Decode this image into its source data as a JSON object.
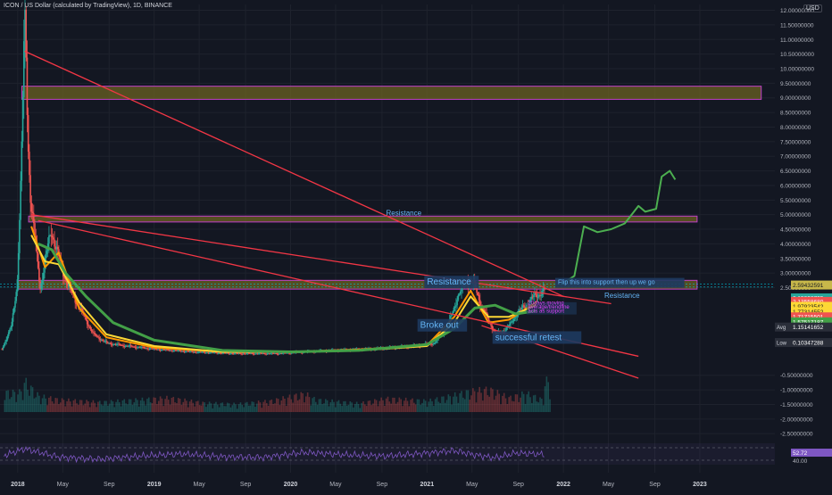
{
  "header": {
    "title": "ICON / US Dollar (calculated by TradingView), 1D, BINANCE",
    "currency": "USD"
  },
  "colors": {
    "background": "#131722",
    "grid": "#1e222d",
    "up": "#26a69a",
    "down": "#ef5350",
    "trendline": "#f23645",
    "zone_fill": "#6b6221",
    "zone_border": "#c040c8",
    "forecast": "#4caf50",
    "ma_green": "#43a047",
    "ma_yellow": "#fdd835",
    "ma_orange": "#ff9800",
    "rsi": "#7e57c2",
    "annotation_box": "#1e3a5f",
    "annotation_text": "#64b5f6",
    "avg_line": "#00bcd4"
  },
  "chart_data": {
    "type": "line",
    "title": "ICON / US Dollar (calculated by TradingView), 1D, BINANCE",
    "xlabel": "",
    "ylabel": "",
    "ylim": [
      -2.8,
      12.2
    ],
    "grid": true,
    "x_ticks": [
      "2018",
      "May",
      "Sep",
      "2019",
      "May",
      "Sep",
      "2020",
      "May",
      "Sep",
      "2021",
      "May",
      "Sep",
      "2022",
      "May",
      "Sep",
      "2023"
    ],
    "y_ticks": [
      "12.00000000",
      "11.50000000",
      "11.00000000",
      "10.50000000",
      "10.00000000",
      "9.50000000",
      "9.00000000",
      "8.50000000",
      "8.00000000",
      "7.50000000",
      "7.00000000",
      "6.50000000",
      "6.00000000",
      "5.50000000",
      "5.00000000",
      "4.50000000",
      "4.00000000",
      "3.50000000",
      "3.00000000",
      "2.50000000",
      "-0.50000000",
      "-1.00000000",
      "-1.50000000",
      "-2.00000000",
      "-2.50000000"
    ],
    "series": [
      {
        "key": "price",
        "x": [
          2017.88,
          2017.95,
          2017.99,
          2018.02,
          2018.04,
          2018.05,
          2018.07,
          2018.09,
          2018.12,
          2018.16,
          2018.2,
          2018.24,
          2018.29,
          2018.33,
          2018.38,
          2018.45,
          2018.55,
          2018.65,
          2018.8,
          2019.0,
          2019.3,
          2019.6,
          2019.9,
          2020.1,
          2020.3,
          2020.6,
          2020.9,
          2021.05,
          2021.15,
          2021.22,
          2021.3,
          2021.35,
          2021.4,
          2021.5,
          2021.55,
          2021.6,
          2021.65,
          2021.72,
          2021.78,
          2021.82,
          2021.86
        ],
        "values": [
          0.4,
          1.2,
          2.6,
          6.5,
          10.5,
          11.7,
          7.5,
          5.5,
          4.2,
          2.5,
          3.5,
          4.5,
          3.6,
          3.0,
          2.4,
          1.8,
          0.9,
          0.6,
          0.5,
          0.4,
          0.3,
          0.25,
          0.25,
          0.3,
          0.35,
          0.4,
          0.5,
          0.6,
          1.2,
          2.2,
          2.8,
          2.5,
          1.8,
          0.9,
          1.0,
          1.2,
          1.6,
          1.9,
          2.2,
          2.3,
          2.4
        ]
      },
      {
        "key": "ma_green",
        "x": [
          2018.15,
          2018.25,
          2018.35,
          2018.5,
          2018.7,
          2019.0,
          2019.5,
          2020.0,
          2020.5,
          2021.0,
          2021.2,
          2021.35,
          2021.5,
          2021.65,
          2021.8
        ],
        "values": [
          4.0,
          3.8,
          3.0,
          2.2,
          1.3,
          0.7,
          0.35,
          0.3,
          0.35,
          0.55,
          1.1,
          1.8,
          1.9,
          1.6,
          1.7
        ]
      },
      {
        "key": "ma_yellow",
        "x": [
          2018.1,
          2018.2,
          2018.3,
          2018.45,
          2018.65,
          2019.0,
          2019.5,
          2020.0,
          2020.5,
          2021.0,
          2021.2,
          2021.32,
          2021.45,
          2021.6,
          2021.8
        ],
        "values": [
          4.3,
          3.4,
          3.3,
          2.0,
          0.9,
          0.5,
          0.3,
          0.3,
          0.35,
          0.5,
          1.3,
          2.2,
          1.5,
          1.5,
          1.9
        ]
      },
      {
        "key": "ma_orange",
        "x": [
          2018.1,
          2018.2,
          2018.3,
          2018.45,
          2018.65,
          2019.0,
          2019.5,
          2020.0,
          2020.5,
          2021.0,
          2021.2,
          2021.32,
          2021.45,
          2021.6,
          2021.8
        ],
        "values": [
          4.6,
          3.2,
          3.7,
          1.8,
          0.8,
          0.45,
          0.3,
          0.3,
          0.38,
          0.52,
          1.5,
          2.4,
          1.3,
          1.4,
          2.0
        ]
      },
      {
        "key": "forecast",
        "x": [
          2021.98,
          2022.08,
          2022.15,
          2022.25,
          2022.35,
          2022.45,
          2022.55,
          2022.6,
          2022.68,
          2022.72,
          2022.78,
          2022.82
        ],
        "values": [
          2.6,
          2.9,
          4.6,
          4.4,
          4.5,
          4.7,
          5.3,
          5.1,
          5.2,
          6.3,
          6.5,
          6.2
        ]
      }
    ],
    "trendlines": [
      {
        "x1": 2018.05,
        "y1": 10.6,
        "x2": 2022.0,
        "y2": 2.2
      },
      {
        "x1": 2018.1,
        "y1": 5.0,
        "x2": 2022.35,
        "y2": 1.95
      },
      {
        "x1": 2018.15,
        "y1": 4.8,
        "x2": 2022.55,
        "y2": 0.15
      },
      {
        "x1": 2021.4,
        "y1": 1.2,
        "x2": 2022.55,
        "y2": -0.6
      }
    ],
    "zones": [
      {
        "x1": 2018.03,
        "x2": 2023.45,
        "y1": 8.95,
        "y2": 9.4
      },
      {
        "x1": 2018.08,
        "x2": 2022.98,
        "y1": 4.75,
        "y2": 4.95
      },
      {
        "x1": 2018.0,
        "x2": 2022.98,
        "y1": 2.45,
        "y2": 2.75
      }
    ],
    "annotations": [
      {
        "text": "Resistance",
        "x": 2020.7,
        "y": 4.98,
        "boxed": false
      },
      {
        "text": "Resistance",
        "x": 2021.0,
        "y": 2.6,
        "boxed": true
      },
      {
        "text": "Flip this into support then up we go",
        "x": 2021.96,
        "y": 2.62,
        "boxed": true
      },
      {
        "text": "Resistance",
        "x": 2022.3,
        "y": 2.15,
        "boxed": false
      },
      {
        "text": "Broke out",
        "x": 2020.95,
        "y": 1.12,
        "boxed": true
      },
      {
        "text": "20days moving",
        "x": 2021.74,
        "y": 1.92,
        "boxed": false
      },
      {
        "text": "average/trendline",
        "x": 2021.74,
        "y": 1.78,
        "boxed": false
      },
      {
        "text": "acts as support",
        "x": 2021.74,
        "y": 1.64,
        "boxed": false
      },
      {
        "text": "successful retest",
        "x": 2021.5,
        "y": 0.7,
        "boxed": true
      }
    ],
    "price_labels": [
      {
        "text": "2.59432591",
        "y": 2.59,
        "color": "#c8b84a"
      },
      {
        "text": "2.15392795",
        "y": 2.15,
        "color": "#26a69a"
      },
      {
        "text": "2.13558680",
        "y": 2.03,
        "color": "#ef5350"
      },
      {
        "text": "1.97923542",
        "y": 1.86,
        "color": "#fdd835"
      },
      {
        "text": "1.77314552",
        "y": 1.68,
        "color": "#fdd835"
      },
      {
        "text": "1.71715501",
        "y": 1.5,
        "color": "#ef5350"
      },
      {
        "text": "1.57517187",
        "y": 1.33,
        "color": "#43a047"
      },
      {
        "text": "1.15141652",
        "y": 1.15,
        "color": "#2a2e39",
        "tag": "Avg"
      },
      {
        "text": "0.10347288",
        "y": 0.62,
        "color": "#2a2e39",
        "tag": "Low"
      }
    ],
    "volume": {
      "x": [
        2018.01,
        2018.05,
        2018.09,
        2018.15,
        2018.3,
        2018.6,
        2019.1,
        2019.35,
        2019.6,
        2019.85,
        2020.1,
        2020.18,
        2020.5,
        2020.7,
        2021.0,
        2021.15,
        2021.3,
        2021.45,
        2021.6,
        2021.72,
        2021.85
      ],
      "values": [
        3.2,
        5.0,
        4.0,
        2.6,
        2.0,
        1.6,
        2.3,
        1.5,
        1.3,
        1.8,
        3.0,
        2.0,
        1.4,
        2.2,
        1.8,
        2.5,
        3.3,
        3.7,
        2.3,
        3.1,
        1.9
      ]
    },
    "rsi": {
      "value_label": "52.72",
      "level_label": "40.00",
      "x": [
        2017.9,
        2018.05,
        2018.3,
        2018.6,
        2018.9,
        2019.2,
        2019.5,
        2019.8,
        2020.1,
        2020.4,
        2020.7,
        2021.0,
        2021.2,
        2021.35,
        2021.5,
        2021.65,
        2021.8,
        2021.86
      ],
      "values": [
        50,
        72,
        45,
        38,
        48,
        55,
        46,
        44,
        60,
        52,
        48,
        58,
        66,
        52,
        42,
        58,
        55,
        53
      ]
    }
  }
}
